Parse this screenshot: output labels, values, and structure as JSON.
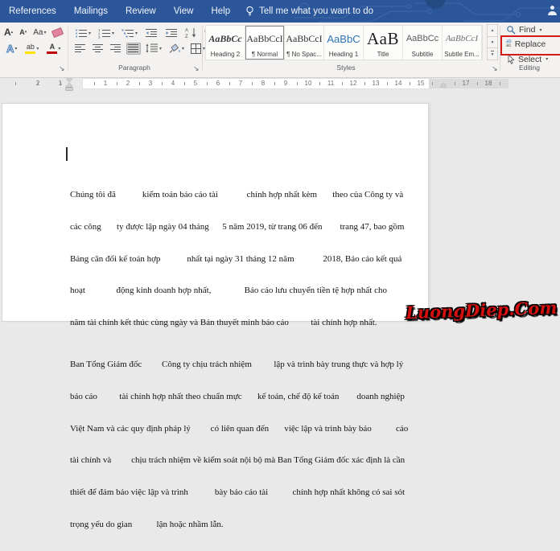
{
  "titlebar": {
    "tabs": [
      "References",
      "Mailings",
      "Review",
      "View",
      "Help"
    ],
    "tell_me": "Tell me what you want to do"
  },
  "ribbon": {
    "font": {
      "grow_label": "A",
      "shrink_label": "A",
      "change_case_label": "Aa",
      "text_effects_label": "A",
      "highlight_label": "ab",
      "font_color_label": "A"
    },
    "paragraph_label": "Paragraph",
    "styles_label": "Styles",
    "styles": [
      {
        "preview": "AaBbCc",
        "label": "Heading 2"
      },
      {
        "preview": "AaBbCcI",
        "label": "¶ Normal"
      },
      {
        "preview": "AaBbCcI",
        "label": "¶ No Spac..."
      },
      {
        "preview": "AaBbC",
        "label": "Heading 1"
      },
      {
        "preview": "AaB",
        "label": "Title"
      },
      {
        "preview": "AaBbCc",
        "label": "Subtitle"
      },
      {
        "preview": "AaBbCcI",
        "label": "Subtle Em..."
      }
    ],
    "editing": {
      "label": "Editing",
      "find": "Find",
      "replace": "Replace",
      "select": "Select",
      "replace_icon_top": "ab",
      "replace_icon_bottom": "ac"
    }
  },
  "ruler": {
    "left_numbers": [
      "2",
      "1"
    ],
    "numbers": [
      "1",
      "2",
      "3",
      "4",
      "5",
      "6",
      "7",
      "8",
      "9",
      "10",
      "11",
      "12",
      "13",
      "14",
      "15"
    ],
    "right_numbers": [
      "17",
      "18"
    ]
  },
  "document": {
    "p1_lines": [
      "Chúng tôi đã            kiểm toán báo cáo tài             chính hợp nhất kèm       theo của Công ty và",
      "các công       ty được lập ngày 04 tháng      5 năm 2019, từ trang 06 đến        trang 47, bao gồm",
      "Bảng cân đối kế toán hợp            nhất tại ngày 31 tháng 12 năm             2018, Báo cáo kết quả",
      "hoạt              động kinh doanh hợp nhất,               Báo cáo lưu chuyển tiền tệ hợp nhất cho",
      "năm tài chính kết thúc cùng ngày và Bản thuyết minh báo cáo          tài chính hợp nhất."
    ],
    "p2_lines": [
      "Ban Tổng Giám đốc         Công ty chịu trách nhiệm          lập và trình bày trung thực và hợp lý",
      "báo cáo          tài chính hợp nhất theo chuẩn mực       kế toán, chế độ kế toán        doanh nghiệp",
      "Việt Nam và các quy định pháp lý         có liên quan đến       việc lập và trình bày báo           cáo",
      "tài chính và         chịu trách nhiệm về kiểm soát nội bộ mà Ban Tổng Giám đốc xác định là cần",
      "thiết để đảm bảo việc lập và trình            bày báo cáo tài           chính hợp nhất không có sai sót",
      "trọng yếu do gian           lận hoặc nhầm lẫn."
    ]
  },
  "watermark": "LuongDiep.Com",
  "colors": {
    "titlebar_blue": "#2b579a",
    "replace_highlight_red": "#d41a1a",
    "heading1_blue": "#2e74b5",
    "highlight_yellow": "#ffe400",
    "font_color_red": "#c00000"
  }
}
